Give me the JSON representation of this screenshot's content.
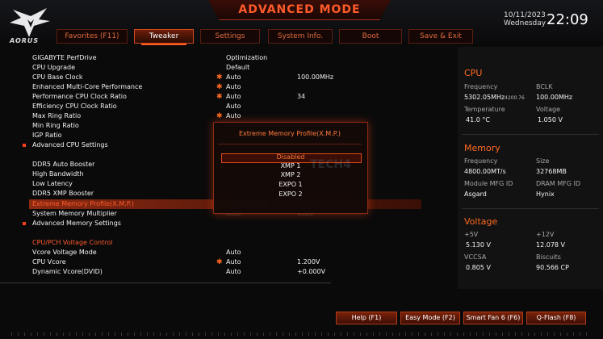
{
  "app": {
    "title": "ADVANCED MODE",
    "brand": "AORUS"
  },
  "datetime": {
    "date": "10/11/2023",
    "weekday": "Wednesday",
    "time": "22:09"
  },
  "tabs": [
    {
      "label": "Favorites (F11)",
      "active": false
    },
    {
      "label": "Tweaker",
      "active": true
    },
    {
      "label": "Settings",
      "active": false
    },
    {
      "label": "System Info.",
      "active": false
    },
    {
      "label": "Boot",
      "active": false
    },
    {
      "label": "Save & Exit",
      "active": false
    }
  ],
  "settings": [
    {
      "label": "GIGABYTE PerfDrive",
      "value": "Optimization",
      "value2": ""
    },
    {
      "label": "CPU Upgrade",
      "value": "Default",
      "value2": ""
    },
    {
      "label": "CPU Base Clock",
      "value": "Auto",
      "value2": "100.00MHz"
    },
    {
      "label": "Enhanced Multi-Core Performance",
      "value": "Auto",
      "value2": ""
    },
    {
      "label": "Performance CPU Clock Ratio",
      "value": "Auto",
      "value2": "34"
    },
    {
      "label": "Efficiency CPU Clock Ratio",
      "value": "Auto",
      "value2": ""
    },
    {
      "label": "Max Ring Ratio",
      "value": "Auto",
      "value2": ""
    },
    {
      "label": "Min Ring Ratio",
      "value": "",
      "value2": ""
    },
    {
      "label": "IGP Ratio",
      "value": "",
      "value2": ""
    },
    {
      "label": "Advanced CPU Settings",
      "value": "",
      "value2": ""
    },
    {
      "label": "DDR5 Auto Booster",
      "value": "",
      "value2": ""
    },
    {
      "label": "High Bandwidth",
      "value": "",
      "value2": ""
    },
    {
      "label": "Low Latency",
      "value": "",
      "value2": ""
    },
    {
      "label": "DDR5 XMP Booster",
      "value": "",
      "value2": ""
    },
    {
      "label": "Extreme Memory Profile(X.M.P.)",
      "value": "",
      "value2": ""
    },
    {
      "label": "System Memory Multiplier",
      "value": "Auto",
      "value2": "4800"
    },
    {
      "label": "Advanced Memory Settings",
      "value": "",
      "value2": ""
    },
    {
      "label": "CPU/PCH Voltage Control",
      "value": "",
      "value2": ""
    },
    {
      "label": "Vcore Voltage Mode",
      "value": "Auto",
      "value2": ""
    },
    {
      "label": "CPU Vcore",
      "value": "Auto",
      "value2": "1.200V"
    },
    {
      "label": "Dynamic Vcore(DVID)",
      "value": "Auto",
      "value2": "+0.000V"
    }
  ],
  "popup": {
    "title": "Extreme Memory Profile(X.M.P.)",
    "options": [
      "Disabled",
      "XMP 1",
      "XMP 2",
      "EXPO 1",
      "EXPO 2"
    ],
    "selected": "Disabled"
  },
  "watermark": "TECH4",
  "cpu": {
    "heading": "CPU",
    "frequency_label": "Frequency",
    "frequency": "5302.05MHz",
    "frequency_sub": "4200.76",
    "bclk_label": "BCLK",
    "bclk": "100.00MHz",
    "temperature_label": "Temperature",
    "temperature": "41.0 °C",
    "voltage_label": "Voltage",
    "voltage": "1.050 V"
  },
  "memory": {
    "heading": "Memory",
    "frequency_label": "Frequency",
    "frequency": "4800.00MT/s",
    "size_label": "Size",
    "size": "32768MB",
    "module_label": "Module MFG ID",
    "module": "Asgard",
    "dram_label": "DRAM MFG ID",
    "dram": "Hynix"
  },
  "voltage": {
    "heading": "Voltage",
    "p5v_label": "+5V",
    "p5v": "5.130 V",
    "p12v_label": "+12V",
    "p12v": "12.078 V",
    "vccsa_label": "VCCSA",
    "vccsa": "0.805 V",
    "biscuits_label": "Biscuits",
    "biscuits": "90.566 CP"
  },
  "footer": {
    "help": "Help (F1)",
    "easy": "Easy Mode (F2)",
    "fan": "Smart Fan 6 (F6)",
    "qflash": "Q-Flash (F8)"
  },
  "colors": {
    "accent": "#ff5a2a",
    "selection": "#8c2a12",
    "background": "#0a0a0b"
  }
}
